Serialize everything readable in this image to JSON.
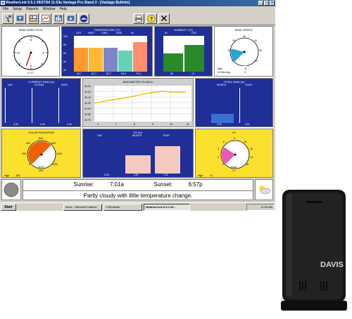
{
  "window": {
    "title": "WeatherLink 5.5.1  09/27/04  11:53a  Vantage Pro Stand 2 - [Vantage Bulletin]"
  },
  "menu": [
    "File",
    "Setup",
    "Reports",
    "Window",
    "Help"
  ],
  "toolbar": {
    "icons": [
      "select-station-icon",
      "download-icon",
      "bulletin-icon",
      "strip-chart-icon",
      "summary-icon",
      "upload-icon",
      "noaa-icon",
      "print-icon",
      "help-icon",
      "close-icon"
    ]
  },
  "wind_direction": {
    "title": "WIND DIRECTION",
    "compass": [
      "N",
      "E",
      "S",
      "W"
    ],
    "reading": "S 17°",
    "direction_degrees": 200
  },
  "temperature": {
    "title": "TEMPERATURE (°F)",
    "columns": [
      "OUT",
      "HEAT",
      "CHILL",
      "DEW",
      "IN"
    ],
    "values": [
      "62.7",
      "62.7",
      "62.7",
      "54.3",
      "70.0"
    ],
    "scale": [
      "100",
      "80",
      "60",
      "40",
      "20"
    ],
    "colors": [
      "#ff9a2e",
      "#ffb833",
      "#7f86c8",
      "#63d3b3",
      "#ff8f6e"
    ]
  },
  "humidity": {
    "title": "HUMIDITY (%)",
    "columns": [
      "IN",
      "OUT"
    ],
    "values": [
      "50",
      "74"
    ],
    "scale": [
      "100",
      "75",
      "50",
      "25",
      "0"
    ]
  },
  "wind_speed": {
    "title": "WIND SPEED",
    "scale": [
      "0",
      "10",
      "20",
      "30",
      "40",
      "50",
      "60"
    ],
    "footer": [
      "Mph",
      "10 Min Avg."
    ],
    "values": [
      "11",
      "9"
    ],
    "gauge_fraction": 0.22
  },
  "current_rain": {
    "title": "CURRENT RAIN (in)",
    "columns": [
      "DAY",
      "STORM",
      "RATE"
    ],
    "values": [
      "0.00",
      "0.00",
      "0.00"
    ]
  },
  "barometer": {
    "title": "BAROMETER 30.069 in",
    "y_ticks": [
      "30.30",
      "30.20",
      "30.10",
      "30.00",
      "29.90",
      "29.80",
      "29.70"
    ],
    "x_ticks": [
      "6",
      "7",
      "8",
      "9",
      "10",
      "11"
    ]
  },
  "total_rain": {
    "title": "TOTAL RAIN (in)",
    "columns": [
      "MONTH",
      "YEAR"
    ],
    "values": [
      "0.91",
      "0.91"
    ]
  },
  "solar": {
    "title": "SOLAR RADIATION",
    "scale": [
      "0",
      "200",
      "400",
      "600",
      "800",
      "1000",
      "1200"
    ],
    "unit": "W/m²",
    "value": "801",
    "footer_label": "High",
    "footer_value": "801"
  },
  "et": {
    "title": "ET (in)",
    "columns": [
      "DAY",
      "MONTH",
      "YEAR"
    ],
    "values": [
      "0.00",
      "4.67",
      "7.01"
    ]
  },
  "uv": {
    "title": "UV",
    "scale": [
      "0",
      "2",
      "4",
      "6",
      "8",
      "10",
      "12",
      "14",
      "16"
    ],
    "footer_label": "High",
    "footer_value": "4.7",
    "unit": "Index",
    "value": "4.7"
  },
  "bottom": {
    "sunrise_label": "Sunrise:",
    "sunrise": "7:01a",
    "sunset_label": "Sunset:",
    "sunset": "6:57p",
    "forecast": "Partly cloudy with little temperature change."
  },
  "taskbar": {
    "start": "Start",
    "tasks": [
      "Inbox - Microsoft Outlook",
      "1 Reminder",
      "WeatherLink 5.5.1  09..."
    ],
    "clock": "11:53 AM"
  },
  "device": {
    "brand": "DAVIS"
  }
}
